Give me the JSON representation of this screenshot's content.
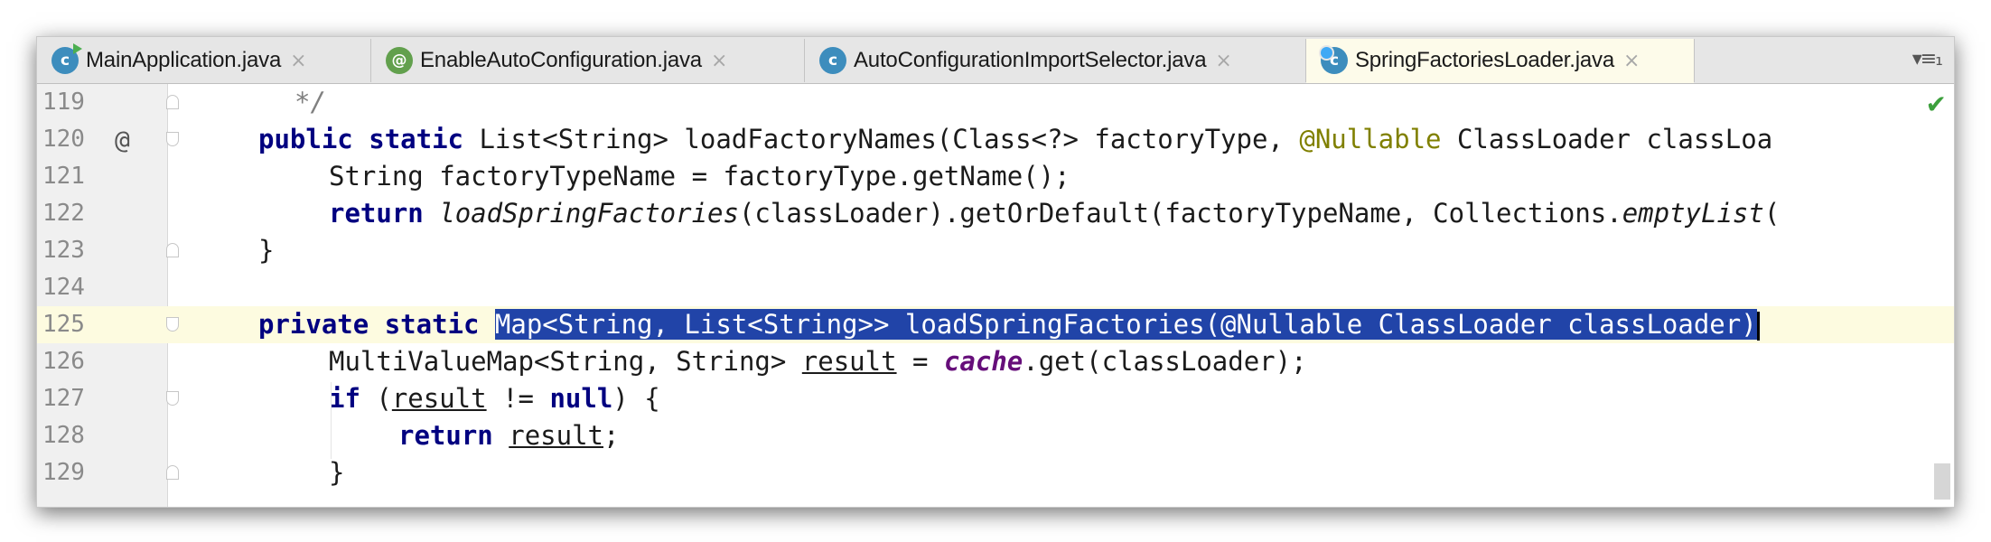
{
  "tabs": [
    {
      "label": "MainApplication.java",
      "icon_letter": "c",
      "icon": "class-run-icon",
      "icon_color": "#3d8dbd"
    },
    {
      "label": "EnableAutoConfiguration.java",
      "icon_letter": "@",
      "icon": "annotation-icon",
      "icon_color": "#62a04d"
    },
    {
      "label": "AutoConfigurationImportSelector.java",
      "icon_letter": "c",
      "icon": "class-icon",
      "icon_color": "#3d8dbd"
    },
    {
      "label": "SpringFactoriesLoader.java",
      "icon_letter": "c",
      "icon": "class-icon",
      "icon_color": "#3d8dbd",
      "active": true
    }
  ],
  "tab_close_glyph": "×",
  "tab_menu_glyph": "▾≡₁",
  "gutter": {
    "lines": [
      "119",
      "120",
      "121",
      "122",
      "123",
      "124",
      "125",
      "126",
      "127",
      "128",
      "129"
    ],
    "override_marker": "@"
  },
  "code": {
    "l119": {
      "comment": "*/"
    },
    "l120": {
      "kw1": "public",
      "kw2": "static",
      "t1": " List<String> loadFactoryNames(Class<?> factoryType, ",
      "ann": "@Nullable",
      "t2": " ClassLoader classLoa"
    },
    "l121": {
      "t1": "String factoryTypeName = factoryType.getName();"
    },
    "l122": {
      "kw": "return",
      "m1": "loadSpringFactories",
      "t1": "(classLoader).getOrDefault(factoryTypeName, Collections.",
      "m2": "emptyList",
      "t2": "("
    },
    "l123": {
      "t1": "}"
    },
    "l125": {
      "kw1": "private",
      "kw2": "static",
      "sel": "Map<String, List<String>> loadSpringFactories(@Nullable ClassLoader classLoader)"
    },
    "l126": {
      "t1": "MultiValueMap<String, String> ",
      "var": "result",
      "t2": " = ",
      "field": "cache",
      "t3": ".get(classLoader);"
    },
    "l127": {
      "kw1": "if",
      "t1": " (",
      "var": "result",
      "t2": " != ",
      "kw2": "null",
      "t3": ") {"
    },
    "l128": {
      "kw": "return",
      "var": "result",
      "t1": ";"
    },
    "l129": {
      "t1": "}"
    }
  },
  "status": {
    "check_glyph": "✔"
  },
  "colors": {
    "keyword": "#000080",
    "annotation": "#808000",
    "field": "#660e7a",
    "selection": "#2144a8",
    "current_line": "#fdfbe0",
    "active_tab": "#fdfbea"
  }
}
